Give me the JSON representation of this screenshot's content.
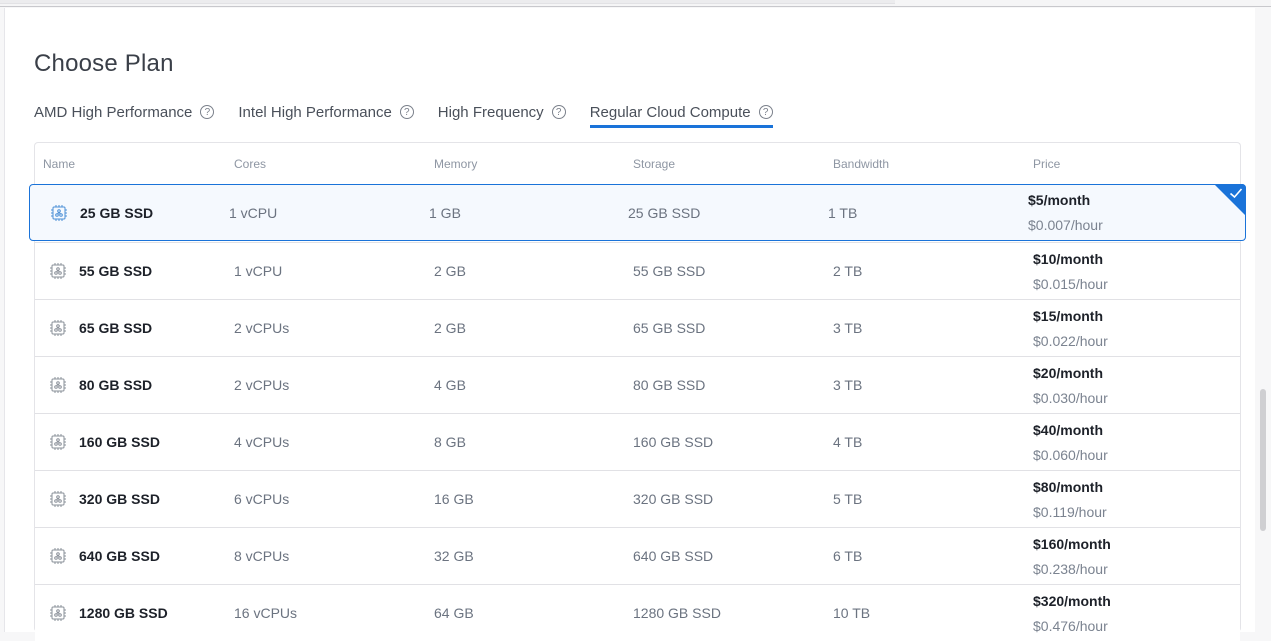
{
  "page": {
    "title": "Choose Plan"
  },
  "tabs": [
    {
      "label": "AMD High Performance",
      "active": false
    },
    {
      "label": "Intel High Performance",
      "active": false
    },
    {
      "label": "High Frequency",
      "active": false
    },
    {
      "label": "Regular Cloud Compute",
      "active": true
    }
  ],
  "help_icon_glyph": "?",
  "table": {
    "headers": {
      "name": "Name",
      "cores": "Cores",
      "memory": "Memory",
      "storage": "Storage",
      "bandwidth": "Bandwidth",
      "price": "Price"
    },
    "rows": [
      {
        "name": "25 GB SSD",
        "cores": "1 vCPU",
        "memory": "1 GB",
        "storage": "25 GB SSD",
        "bandwidth": "1 TB",
        "price_month": "$5/month",
        "price_hour": "$0.007/hour",
        "selected": true
      },
      {
        "name": "55 GB SSD",
        "cores": "1 vCPU",
        "memory": "2 GB",
        "storage": "55 GB SSD",
        "bandwidth": "2 TB",
        "price_month": "$10/month",
        "price_hour": "$0.015/hour",
        "selected": false
      },
      {
        "name": "65 GB SSD",
        "cores": "2 vCPUs",
        "memory": "2 GB",
        "storage": "65 GB SSD",
        "bandwidth": "3 TB",
        "price_month": "$15/month",
        "price_hour": "$0.022/hour",
        "selected": false
      },
      {
        "name": "80 GB SSD",
        "cores": "2 vCPUs",
        "memory": "4 GB",
        "storage": "80 GB SSD",
        "bandwidth": "3 TB",
        "price_month": "$20/month",
        "price_hour": "$0.030/hour",
        "selected": false
      },
      {
        "name": "160 GB SSD",
        "cores": "4 vCPUs",
        "memory": "8 GB",
        "storage": "160 GB SSD",
        "bandwidth": "4 TB",
        "price_month": "$40/month",
        "price_hour": "$0.060/hour",
        "selected": false
      },
      {
        "name": "320 GB SSD",
        "cores": "6 vCPUs",
        "memory": "16 GB",
        "storage": "320 GB SSD",
        "bandwidth": "5 TB",
        "price_month": "$80/month",
        "price_hour": "$0.119/hour",
        "selected": false
      },
      {
        "name": "640 GB SSD",
        "cores": "8 vCPUs",
        "memory": "32 GB",
        "storage": "640 GB SSD",
        "bandwidth": "6 TB",
        "price_month": "$160/month",
        "price_hour": "$0.238/hour",
        "selected": false
      },
      {
        "name": "1280 GB SSD",
        "cores": "16 vCPUs",
        "memory": "64 GB",
        "storage": "1280 GB SSD",
        "bandwidth": "10 TB",
        "price_month": "$320/month",
        "price_hour": "$0.476/hour",
        "selected": false
      }
    ]
  },
  "colors": {
    "accent": "#1a73d9",
    "selected_bg": "#f5f9fe",
    "icon_selected": "#4a8fd6",
    "icon_default": "#8a9099"
  }
}
